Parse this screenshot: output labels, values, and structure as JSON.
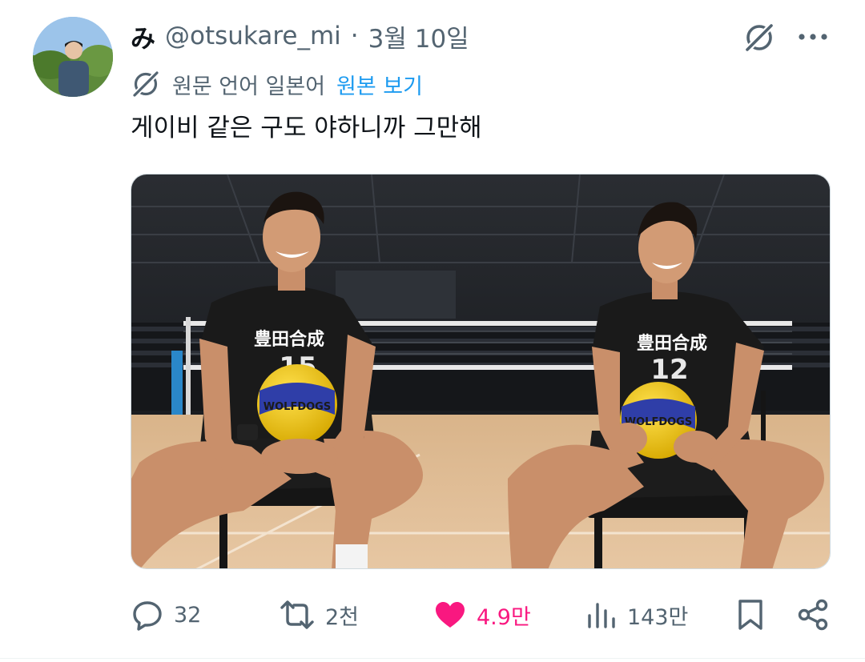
{
  "tweet": {
    "display_name": "み",
    "handle": "@otsukare_mi",
    "separator": "·",
    "date": "3월 10일",
    "translation": {
      "source_language": "원문 언어 일본어",
      "view_original": "원본 보기"
    },
    "text": "게이비 같은 구도 야하니까 그만해",
    "media": {
      "jersey_text": "豊田合成",
      "ball_text": "WOLFDOGS",
      "left_number": "15",
      "right_number": "12"
    }
  },
  "icons": {
    "translate": "translate-icon",
    "more": "more-icon",
    "reply": "reply-icon",
    "retweet": "retweet-icon",
    "like": "heart-icon",
    "views": "views-icon",
    "bookmark": "bookmark-icon",
    "share": "share-icon"
  },
  "actions": {
    "replies": "32",
    "retweets": "2천",
    "likes": "4.9만",
    "views": "143만"
  },
  "colors": {
    "accent": "#1d9bf0",
    "like": "#f91880",
    "secondary_text": "#536471"
  }
}
